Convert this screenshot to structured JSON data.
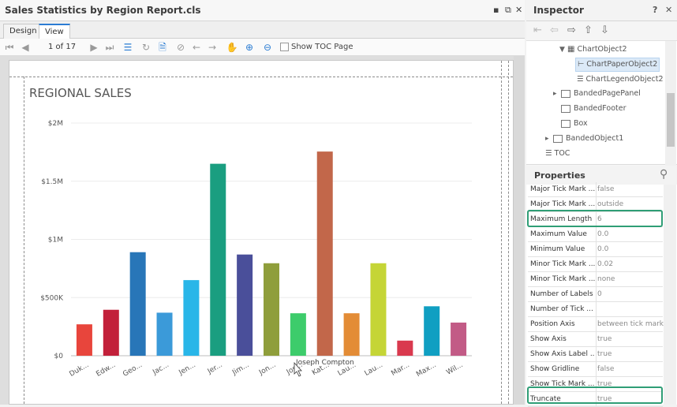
{
  "report": {
    "title": "Sales Statistics by Region Report.cls",
    "tabs": [
      {
        "label": "Design"
      },
      {
        "label": "View"
      }
    ],
    "page_indicator": "1 of 17",
    "show_toc_label": "Show TOC Page"
  },
  "inspector": {
    "title": "Inspector",
    "help": "?",
    "tree": [
      {
        "label": "ChartObject2"
      },
      {
        "label": "ChartPaperObject2"
      },
      {
        "label": "ChartLegendObject2"
      },
      {
        "label": "BandedPagePanel"
      },
      {
        "label": "BandedFooter"
      },
      {
        "label": "Box"
      },
      {
        "label": "BandedObject1"
      },
      {
        "label": "TOC"
      }
    ],
    "properties_title": "Properties",
    "properties": [
      {
        "name": "Major Tick Mark ...",
        "value": "false"
      },
      {
        "name": "Major Tick Mark ...",
        "value": "outside"
      },
      {
        "name": "Maximum Length",
        "value": "6"
      },
      {
        "name": "Maximum Value",
        "value": "0.0"
      },
      {
        "name": "Minimum Value",
        "value": "0.0"
      },
      {
        "name": "Minor Tick Mark ...",
        "value": "0.02"
      },
      {
        "name": "Minor Tick Mark ...",
        "value": "none"
      },
      {
        "name": "Number of Labels",
        "value": "0"
      },
      {
        "name": "Number of Tick ...",
        "value": ""
      },
      {
        "name": "Position Axis",
        "value": "between tick marks"
      },
      {
        "name": "Show Axis",
        "value": "true"
      },
      {
        "name": "Show Axis Label ...",
        "value": "true"
      },
      {
        "name": "Show Gridline",
        "value": "false"
      },
      {
        "name": "Show Tick Mark ...",
        "value": "true"
      },
      {
        "name": "Truncate",
        "value": "true"
      }
    ],
    "accent": "#2f9e76"
  },
  "chart_data": {
    "type": "bar",
    "title": "REGIONAL SALES",
    "categories": [
      "Duk...",
      "Edw...",
      "Geo...",
      "Jac...",
      "Jen...",
      "Jer...",
      "Jim...",
      "Jon...",
      "Jos...",
      "Kat...",
      "Lau...",
      "Lau...",
      "Mar...",
      "Max...",
      "Wil..."
    ],
    "values": [
      270000,
      395000,
      890000,
      370000,
      650000,
      1650000,
      870000,
      795000,
      365000,
      1755000,
      365000,
      795000,
      130000,
      425000,
      285000
    ],
    "colors": [
      "#e8453c",
      "#c2203a",
      "#2876b8",
      "#3b9ad9",
      "#29b6e8",
      "#1a9e80",
      "#4a4f9a",
      "#8f9e3b",
      "#3dcc6b",
      "#c2674a",
      "#e38c36",
      "#c5d536",
      "#d9394e",
      "#109fc2",
      "#c25b86"
    ],
    "y_ticks": [
      "$0",
      "$500K",
      "$1M",
      "$1.5M",
      "$2M"
    ],
    "ylim": [
      0,
      2000000
    ],
    "tooltip": "Joseph Compton",
    "xlabel": "",
    "ylabel": ""
  }
}
